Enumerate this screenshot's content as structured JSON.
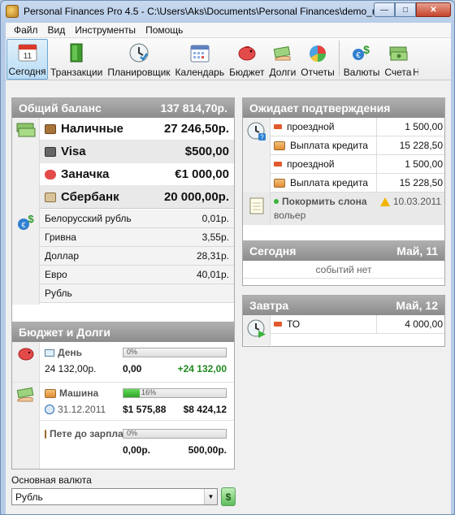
{
  "window": {
    "title": "Personal Finances Pro 4.5 - C:\\Users\\Aks\\Documents\\Personal Finances\\demo_russia..."
  },
  "menu": [
    "Файл",
    "Вид",
    "Инструменты",
    "Помощь"
  ],
  "toolbar": [
    {
      "label": "Сегодня",
      "icon": "calendar-today-icon",
      "active": true
    },
    {
      "label": "Транзакции",
      "icon": "door-icon"
    },
    {
      "label": "Планировщик",
      "icon": "clock-icon"
    },
    {
      "label": "Календарь",
      "icon": "calendar-icon"
    },
    {
      "label": "Бюджет",
      "icon": "piggy-bank-icon"
    },
    {
      "label": "Долги",
      "icon": "money-hand-icon"
    },
    {
      "label": "Отчеты",
      "icon": "pie-chart-icon"
    },
    {
      "label": "Валюты",
      "icon": "currency-exchange-icon"
    },
    {
      "label": "Счета",
      "icon": "money-stack-icon"
    },
    {
      "label": "Н",
      "icon": ""
    }
  ],
  "balance": {
    "title": "Общий баланс",
    "total": "137 814,70р.",
    "accounts": [
      {
        "name": "Наличные",
        "amount": "27 246,50р."
      },
      {
        "name": "Visa",
        "amount": "$500,00"
      },
      {
        "name": "Заначка",
        "amount": "€1 000,00"
      },
      {
        "name": "Сбербанк",
        "amount": "20 000,00р."
      }
    ],
    "currencies": [
      {
        "name": "Белорусский рубль",
        "amount": "0,01р."
      },
      {
        "name": "Гривна",
        "amount": "3,55р."
      },
      {
        "name": "Доллар",
        "amount": "28,31р."
      },
      {
        "name": "Евро",
        "amount": "40,01р."
      },
      {
        "name": "Рубль",
        "amount": ""
      }
    ]
  },
  "budget": {
    "title": "Бюджет и Долги",
    "items": [
      {
        "name": "День",
        "sub": "24 132,00р.",
        "percent": 0,
        "percent_label": "0%",
        "left": "0,00",
        "right": "+24 132,00",
        "right_color": "#1f8a1f"
      },
      {
        "name": "Машина",
        "sub": "31.12.2011",
        "percent": 16,
        "percent_label": "16%",
        "left": "$1 575,88",
        "right": "$8 424,12",
        "right_color": "#111111"
      },
      {
        "name": "Пете до зарплаты",
        "sub": "",
        "percent": 0,
        "percent_label": "0%",
        "left": "0,00р.",
        "right": "500,00р.",
        "right_color": "#111111"
      }
    ]
  },
  "pending": {
    "title": "Ожидает подтверждения",
    "rows": [
      {
        "type": "minus",
        "label": "проездной",
        "amount": "1 500,00"
      },
      {
        "type": "card",
        "label": "Выплата кредита",
        "amount": "15 228,50"
      },
      {
        "type": "minus",
        "label": "проездной",
        "amount": "1 500,00"
      },
      {
        "type": "card",
        "label": "Выплата кредита",
        "amount": "15 228,50"
      }
    ],
    "task": {
      "title": "Покормить слона",
      "date": "10.03.2011",
      "note": "вольер"
    }
  },
  "today": {
    "title": "Сегодня",
    "date": "Май, 11",
    "empty": "событий нет"
  },
  "tomorrow": {
    "title": "Завтра",
    "date": "Май, 12",
    "rows": [
      {
        "label": "ТО",
        "amount": "4 000,00"
      }
    ]
  },
  "footer": {
    "label": "Основная валюта",
    "currency": "Рубль"
  },
  "colors": {
    "header_bg": "#999999",
    "accent": "#2fa62a",
    "minus": "#e05a2c"
  }
}
